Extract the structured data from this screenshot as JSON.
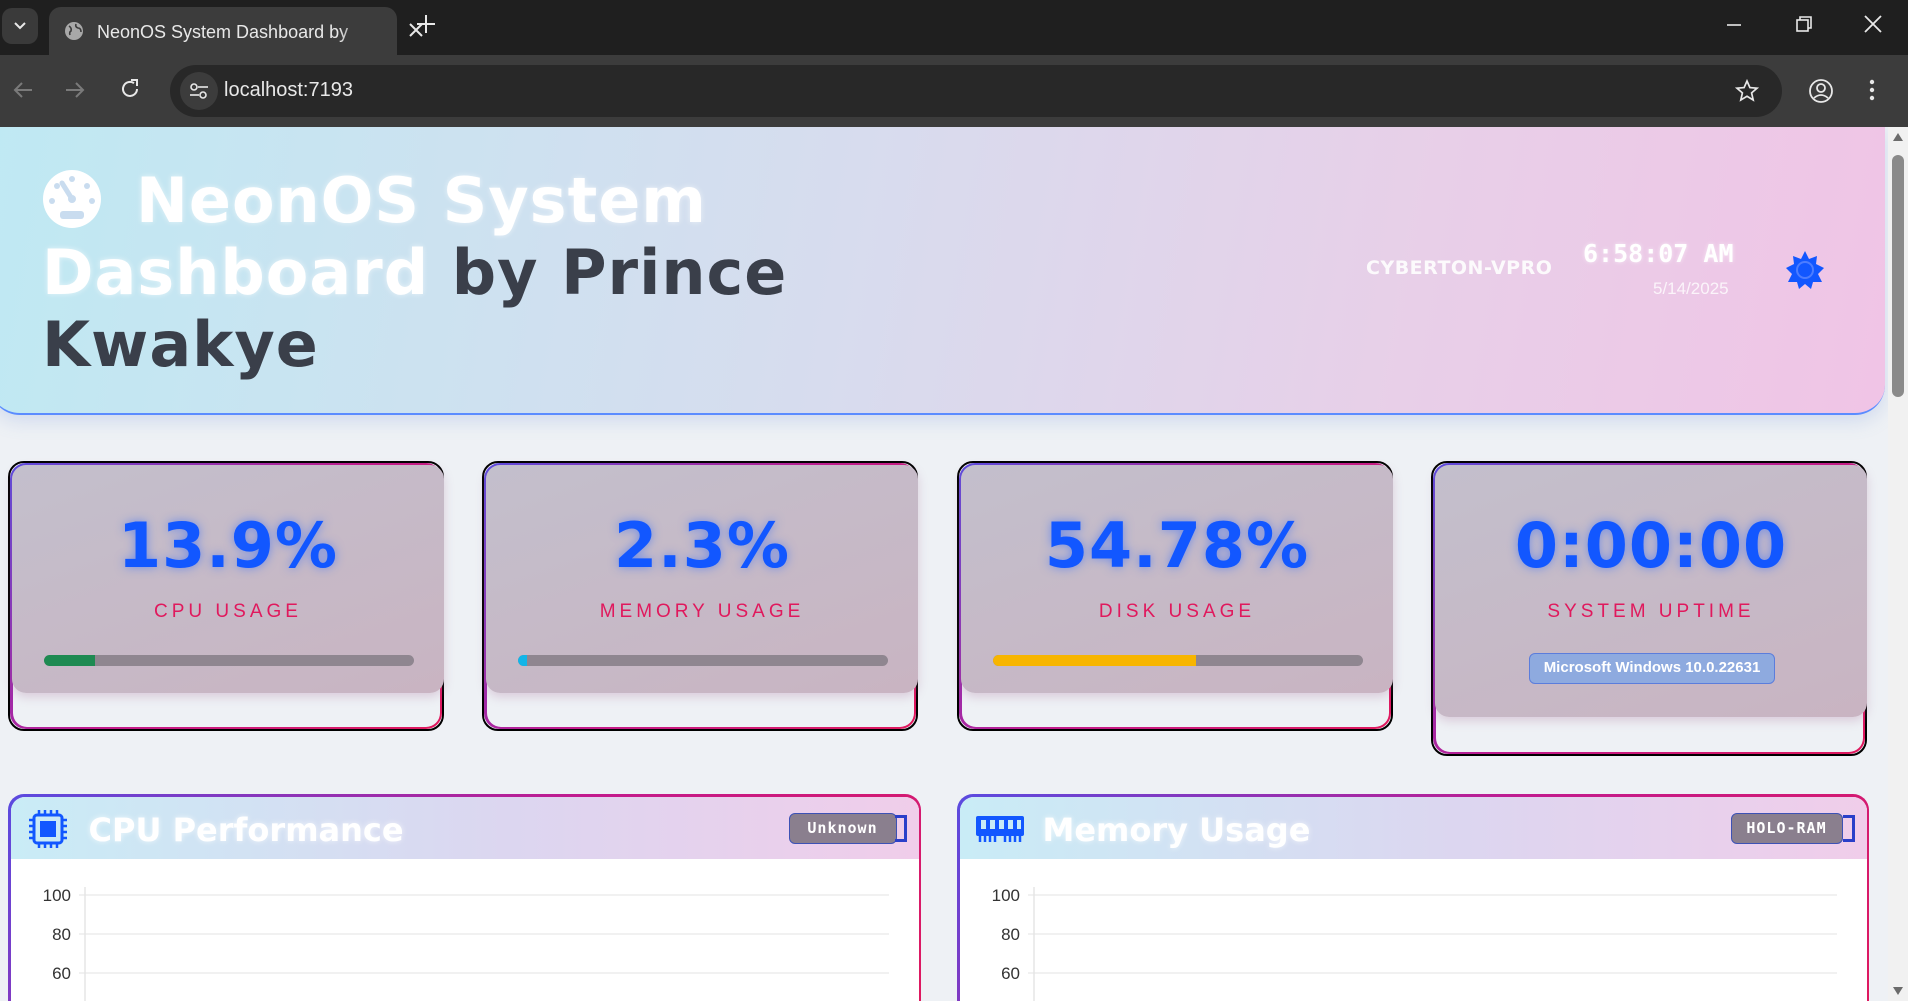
{
  "browser": {
    "tab_title": "NeonOS System Dashboard by Prince Kwakye",
    "url": "localhost:7193"
  },
  "header": {
    "title_part1": "NeonOS System Dashboard",
    "title_part2": "by Prince Kwakye",
    "title_line1": "NeonOS System",
    "title_line2a": "Dashboard",
    "title_line2b": " by Prince",
    "title_line3": "Kwakye",
    "hostname": "CYBERTON-VPRO",
    "time": "6:58:07 AM",
    "date": "5/14/2025"
  },
  "stats": [
    {
      "value": "13.9%",
      "label": "CPU USAGE",
      "progress": 0.139,
      "bar_color": "#1e8a52"
    },
    {
      "value": "2.3%",
      "label": "MEMORY USAGE",
      "progress": 0.023,
      "bar_color": "#12b5e8"
    },
    {
      "value": "54.78%",
      "label": "DISK USAGE",
      "progress": 0.5478,
      "bar_color": "#f7b500"
    },
    {
      "value": "0:00:00",
      "label": "SYSTEM UPTIME",
      "os": "Microsoft Windows 10.0.22631"
    }
  ],
  "panels": [
    {
      "title": "CPU Performance",
      "badge": "Unknown",
      "icon": "cpu-chip-icon",
      "y_ticks": [
        "100",
        "80",
        "60"
      ]
    },
    {
      "title": "Memory Usage",
      "badge": "HOLO-RAM",
      "icon": "ram-module-icon",
      "y_ticks": [
        "100",
        "80",
        "60"
      ]
    }
  ],
  "colors": {
    "accent_blue": "#1257ff",
    "accent_pink": "#e0195d"
  }
}
